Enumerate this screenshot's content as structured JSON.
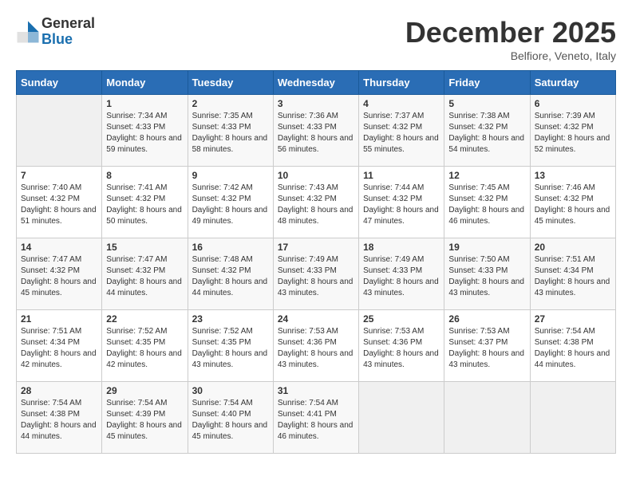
{
  "logo": {
    "general": "General",
    "blue": "Blue"
  },
  "header": {
    "title": "December 2025",
    "location": "Belfiore, Veneto, Italy"
  },
  "days_of_week": [
    "Sunday",
    "Monday",
    "Tuesday",
    "Wednesday",
    "Thursday",
    "Friday",
    "Saturday"
  ],
  "weeks": [
    [
      {
        "day": "",
        "sunrise": "",
        "sunset": "",
        "daylight": ""
      },
      {
        "day": "1",
        "sunrise": "Sunrise: 7:34 AM",
        "sunset": "Sunset: 4:33 PM",
        "daylight": "Daylight: 8 hours and 59 minutes."
      },
      {
        "day": "2",
        "sunrise": "Sunrise: 7:35 AM",
        "sunset": "Sunset: 4:33 PM",
        "daylight": "Daylight: 8 hours and 58 minutes."
      },
      {
        "day": "3",
        "sunrise": "Sunrise: 7:36 AM",
        "sunset": "Sunset: 4:33 PM",
        "daylight": "Daylight: 8 hours and 56 minutes."
      },
      {
        "day": "4",
        "sunrise": "Sunrise: 7:37 AM",
        "sunset": "Sunset: 4:32 PM",
        "daylight": "Daylight: 8 hours and 55 minutes."
      },
      {
        "day": "5",
        "sunrise": "Sunrise: 7:38 AM",
        "sunset": "Sunset: 4:32 PM",
        "daylight": "Daylight: 8 hours and 54 minutes."
      },
      {
        "day": "6",
        "sunrise": "Sunrise: 7:39 AM",
        "sunset": "Sunset: 4:32 PM",
        "daylight": "Daylight: 8 hours and 52 minutes."
      }
    ],
    [
      {
        "day": "7",
        "sunrise": "Sunrise: 7:40 AM",
        "sunset": "Sunset: 4:32 PM",
        "daylight": "Daylight: 8 hours and 51 minutes."
      },
      {
        "day": "8",
        "sunrise": "Sunrise: 7:41 AM",
        "sunset": "Sunset: 4:32 PM",
        "daylight": "Daylight: 8 hours and 50 minutes."
      },
      {
        "day": "9",
        "sunrise": "Sunrise: 7:42 AM",
        "sunset": "Sunset: 4:32 PM",
        "daylight": "Daylight: 8 hours and 49 minutes."
      },
      {
        "day": "10",
        "sunrise": "Sunrise: 7:43 AM",
        "sunset": "Sunset: 4:32 PM",
        "daylight": "Daylight: 8 hours and 48 minutes."
      },
      {
        "day": "11",
        "sunrise": "Sunrise: 7:44 AM",
        "sunset": "Sunset: 4:32 PM",
        "daylight": "Daylight: 8 hours and 47 minutes."
      },
      {
        "day": "12",
        "sunrise": "Sunrise: 7:45 AM",
        "sunset": "Sunset: 4:32 PM",
        "daylight": "Daylight: 8 hours and 46 minutes."
      },
      {
        "day": "13",
        "sunrise": "Sunrise: 7:46 AM",
        "sunset": "Sunset: 4:32 PM",
        "daylight": "Daylight: 8 hours and 45 minutes."
      }
    ],
    [
      {
        "day": "14",
        "sunrise": "Sunrise: 7:47 AM",
        "sunset": "Sunset: 4:32 PM",
        "daylight": "Daylight: 8 hours and 45 minutes."
      },
      {
        "day": "15",
        "sunrise": "Sunrise: 7:47 AM",
        "sunset": "Sunset: 4:32 PM",
        "daylight": "Daylight: 8 hours and 44 minutes."
      },
      {
        "day": "16",
        "sunrise": "Sunrise: 7:48 AM",
        "sunset": "Sunset: 4:32 PM",
        "daylight": "Daylight: 8 hours and 44 minutes."
      },
      {
        "day": "17",
        "sunrise": "Sunrise: 7:49 AM",
        "sunset": "Sunset: 4:33 PM",
        "daylight": "Daylight: 8 hours and 43 minutes."
      },
      {
        "day": "18",
        "sunrise": "Sunrise: 7:49 AM",
        "sunset": "Sunset: 4:33 PM",
        "daylight": "Daylight: 8 hours and 43 minutes."
      },
      {
        "day": "19",
        "sunrise": "Sunrise: 7:50 AM",
        "sunset": "Sunset: 4:33 PM",
        "daylight": "Daylight: 8 hours and 43 minutes."
      },
      {
        "day": "20",
        "sunrise": "Sunrise: 7:51 AM",
        "sunset": "Sunset: 4:34 PM",
        "daylight": "Daylight: 8 hours and 43 minutes."
      }
    ],
    [
      {
        "day": "21",
        "sunrise": "Sunrise: 7:51 AM",
        "sunset": "Sunset: 4:34 PM",
        "daylight": "Daylight: 8 hours and 42 minutes."
      },
      {
        "day": "22",
        "sunrise": "Sunrise: 7:52 AM",
        "sunset": "Sunset: 4:35 PM",
        "daylight": "Daylight: 8 hours and 42 minutes."
      },
      {
        "day": "23",
        "sunrise": "Sunrise: 7:52 AM",
        "sunset": "Sunset: 4:35 PM",
        "daylight": "Daylight: 8 hours and 43 minutes."
      },
      {
        "day": "24",
        "sunrise": "Sunrise: 7:53 AM",
        "sunset": "Sunset: 4:36 PM",
        "daylight": "Daylight: 8 hours and 43 minutes."
      },
      {
        "day": "25",
        "sunrise": "Sunrise: 7:53 AM",
        "sunset": "Sunset: 4:36 PM",
        "daylight": "Daylight: 8 hours and 43 minutes."
      },
      {
        "day": "26",
        "sunrise": "Sunrise: 7:53 AM",
        "sunset": "Sunset: 4:37 PM",
        "daylight": "Daylight: 8 hours and 43 minutes."
      },
      {
        "day": "27",
        "sunrise": "Sunrise: 7:54 AM",
        "sunset": "Sunset: 4:38 PM",
        "daylight": "Daylight: 8 hours and 44 minutes."
      }
    ],
    [
      {
        "day": "28",
        "sunrise": "Sunrise: 7:54 AM",
        "sunset": "Sunset: 4:38 PM",
        "daylight": "Daylight: 8 hours and 44 minutes."
      },
      {
        "day": "29",
        "sunrise": "Sunrise: 7:54 AM",
        "sunset": "Sunset: 4:39 PM",
        "daylight": "Daylight: 8 hours and 45 minutes."
      },
      {
        "day": "30",
        "sunrise": "Sunrise: 7:54 AM",
        "sunset": "Sunset: 4:40 PM",
        "daylight": "Daylight: 8 hours and 45 minutes."
      },
      {
        "day": "31",
        "sunrise": "Sunrise: 7:54 AM",
        "sunset": "Sunset: 4:41 PM",
        "daylight": "Daylight: 8 hours and 46 minutes."
      },
      {
        "day": "",
        "sunrise": "",
        "sunset": "",
        "daylight": ""
      },
      {
        "day": "",
        "sunrise": "",
        "sunset": "",
        "daylight": ""
      },
      {
        "day": "",
        "sunrise": "",
        "sunset": "",
        "daylight": ""
      }
    ]
  ]
}
